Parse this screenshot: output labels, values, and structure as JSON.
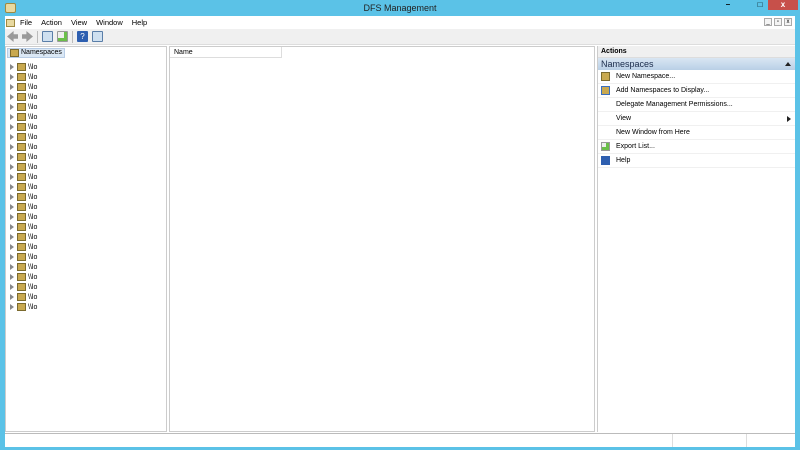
{
  "window": {
    "title": "DFS Management",
    "minimize": "–",
    "maximize": "□",
    "close": "x",
    "mdi_minimize": "_",
    "mdi_restore": "▫",
    "mdi_close": "x"
  },
  "menu": [
    "File",
    "Action",
    "View",
    "Window",
    "Help"
  ],
  "toolbar": {
    "buttons": [
      "back-icon",
      "forward-icon",
      "show-hide-console-tree-icon",
      "export-icon",
      "help-icon",
      "show-hide-action-pane-icon"
    ]
  },
  "tree": {
    "root": "Namespaces",
    "nodes": [
      "\\\\lo",
      "\\\\lo",
      "\\\\lo",
      "\\\\lo",
      "\\\\lo",
      "\\\\lo",
      "\\\\lo",
      "\\\\lo",
      "\\\\lo",
      "\\\\lo",
      "\\\\lo",
      "\\\\lo",
      "\\\\lo",
      "\\\\lo",
      "\\\\lo",
      "\\\\lo",
      "\\\\lo",
      "\\\\lo",
      "\\\\lo",
      "\\\\lo",
      "\\\\lo",
      "\\\\lo",
      "\\\\lo",
      "\\\\lo",
      "\\\\lo"
    ]
  },
  "list": {
    "columns": [
      "Name"
    ]
  },
  "actions": {
    "header": "Actions",
    "section": "Namespaces",
    "items": [
      {
        "label": "New Namespace...",
        "icon": "new-namespace-icon"
      },
      {
        "label": "Add Namespaces to Display...",
        "icon": "add-namespace-icon"
      },
      {
        "label": "Delegate Management Permissions...",
        "icon": ""
      },
      {
        "label": "View",
        "icon": "",
        "submenu": true
      },
      {
        "label": "New Window from Here",
        "icon": ""
      },
      {
        "label": "Export List...",
        "icon": "export-icon"
      },
      {
        "label": "Help",
        "icon": "help-icon"
      }
    ]
  },
  "colors": {
    "titlebar": "#5bc2e7",
    "close": "#c7504a",
    "selection": "#dbe8f5"
  }
}
